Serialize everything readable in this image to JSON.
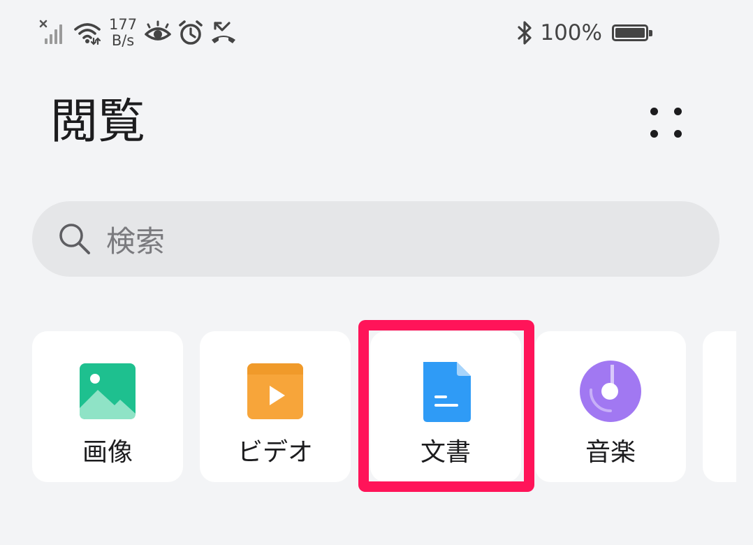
{
  "status_bar": {
    "net_speed_value": "177",
    "net_speed_unit": "B/s",
    "battery_percent": "100%",
    "icons": [
      "no-signal-icon",
      "wifi-icon",
      "eye-comfort-icon",
      "alarm-icon",
      "missed-call-icon",
      "bluetooth-icon",
      "battery-icon"
    ]
  },
  "header": {
    "title": "閲覧",
    "more_icon": "more-dots-icon"
  },
  "search": {
    "placeholder": "検索",
    "icon": "search-icon"
  },
  "categories": [
    {
      "label": "画像",
      "icon": "image-icon",
      "color": "#1ec08f"
    },
    {
      "label": "ビデオ",
      "icon": "video-icon",
      "color": "#f7a53a"
    },
    {
      "label": "文書",
      "icon": "document-icon",
      "color": "#2f9bf6",
      "highlighted": true
    },
    {
      "label": "音楽",
      "icon": "music-icon",
      "color": "#a178f2"
    }
  ],
  "colors": {
    "background": "#f3f4f6",
    "search_background": "#e5e6e8",
    "highlight": "#ff1459"
  }
}
